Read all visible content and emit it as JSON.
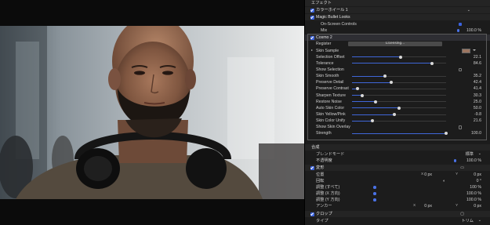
{
  "inspector": {
    "effects_header": "エフェクト",
    "color_wheels": "カラーホイール 1",
    "magic_bullet": "Magic Bullet Looks",
    "on_screen_controls": "On-Screen Controls",
    "mix_label": "Mix",
    "mix_value": "100.0 %",
    "cosmo_title": "Cosmo 2",
    "register_label": "Register",
    "licensing_label": "Licensing...",
    "cosmo_rows": [
      {
        "label": "Skin Sample"
      },
      {
        "label": "Selection Offset",
        "value": "22.1",
        "level": 0.52
      },
      {
        "label": "Tolerance",
        "value": "84.6",
        "level": 0.85
      },
      {
        "label": "Show Selection"
      },
      {
        "label": "Skin Smooth",
        "value": "35.2",
        "level": 0.35
      },
      {
        "label": "Preserve Detail",
        "value": "42.4",
        "level": 0.42
      },
      {
        "label": "Preserve Contrast",
        "value": "41.4",
        "level": 0.06
      },
      {
        "label": "Sharpen Texture",
        "value": "30.3",
        "level": 0.11
      },
      {
        "label": "Restore Noise",
        "value": "25.0",
        "level": 0.25
      },
      {
        "label": "Auto Skin Color",
        "value": "50.0",
        "level": 0.5
      },
      {
        "label": "Skin Yellow/Pink",
        "value": "-9.8",
        "level": 0.45
      },
      {
        "label": "Skin Color Unify",
        "value": "21.6",
        "level": 0.22
      },
      {
        "label": "Show Skin Overlay"
      },
      {
        "label": "Strength",
        "value": "100.0",
        "level": 1.0
      }
    ],
    "composite_header": "合成",
    "blend_mode_label": "ブレンドモード",
    "blend_mode_value": "標準",
    "opacity_label": "不透明度",
    "opacity_value": "100.0 %",
    "transform_header": "変形",
    "position_label": "位置",
    "position_x_label": "X",
    "position_x_value": "0 px",
    "position_y_label": "Y",
    "position_y_value": "0 px",
    "rotation_label": "回転",
    "rotation_value": "0 °",
    "scale_all_label": "調整 (すべて)",
    "scale_all_value": "100 %",
    "scale_x_label": "調整 (X 方向)",
    "scale_x_value": "100.0 %",
    "scale_y_label": "調整 (Y 方向)",
    "scale_y_value": "100.0 %",
    "anchor_label": "アンカー",
    "anchor_x_label": "X",
    "anchor_x_value": "0 px",
    "anchor_y_label": "Y",
    "anchor_y_value": "0 px",
    "crop_header": "クロップ",
    "type_label": "タイプ",
    "type_value": "トリム"
  },
  "colors": {
    "accent": "#3b63e0",
    "panel_bg": "#1c1c1c",
    "header_bg": "#242424"
  },
  "icons": [
    "checkbox-checked-icon",
    "disclosure-triangle-icon",
    "chevron-down-icon",
    "transform-square-icon",
    "rotation-dial-icon",
    "crop-square-icon"
  ]
}
